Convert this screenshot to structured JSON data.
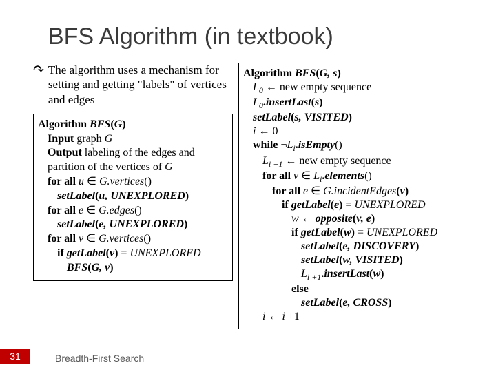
{
  "title": "BFS Algorithm (in textbook)",
  "bullet": "The algorithm uses a mechanism for setting and getting \"labels\" of vertices and edges",
  "bullet_glyph": "↷",
  "left": {
    "l1a": "Algorithm",
    "l1b": "BFS",
    "l1c": "(",
    "l1d": "G",
    "l1e": ")",
    "l2a": "Input",
    "l2b": " graph ",
    "l2c": "G",
    "l3a": "Output",
    "l3b": " labeling of the edges and partition of the vertices  of ",
    "l3c": "G",
    "l4a": "for all ",
    "l4b": "u",
    "l4c": " ∈ ",
    "l4d": "G.vertices",
    "l4e": "()",
    "l5a": "setLabel",
    "l5b": "(",
    "l5c": "u, UNEXPLORED",
    "l5d": ")",
    "l6a": "for all ",
    "l6b": "e",
    "l6c": " ∈ ",
    "l6d": "G.edges",
    "l6e": "()",
    "l7a": "setLabel",
    "l7b": "(",
    "l7c": "e, UNEXPLORED",
    "l7d": ")",
    "l8a": "for all ",
    "l8b": "v",
    "l8c": " ∈ ",
    "l8d": "G.vertices",
    "l8e": "()",
    "l9a": "if  ",
    "l9b": "getLabel",
    "l9c": "(",
    "l9d": "v",
    "l9e": ") ",
    "l9f": "=",
    "l9g": " UNEXPLORED",
    "l10a": "BFS",
    "l10b": "(",
    "l10c": "G, v",
    "l10d": ")"
  },
  "right": {
    "r1a": "Algorithm",
    "r1b": "BFS",
    "r1c": "(",
    "r1d": "G, s",
    "r1e": ")",
    "r2a": "L",
    "r2b": "0",
    "r2c": " ← new empty sequence",
    "r3a": "L",
    "r3b": "0",
    "r3c": ".",
    "r3d": "insertLast",
    "r3e": "(",
    "r3f": "s",
    "r3g": ")",
    "r4a": "setLabel",
    "r4b": "(",
    "r4c": "s, VISITED",
    "r4d": ")",
    "r5a": "i",
    "r5b": " ← 0",
    "r6a": "while  ",
    "r6b": "¬",
    "r6c": "L",
    "r6d": "i",
    "r6e": ".",
    "r6f": "isEmpty",
    "r6g": "()",
    "r7a": "L",
    "r7b": "i +1",
    "r7c": " ← new empty sequence",
    "r8a": "for all ",
    "r8b": "v",
    "r8c": " ∈ ",
    "r8d": "L",
    "r8e": "i",
    "r8f": ".",
    "r8g": "elements",
    "r8h": "()",
    "r9a": "for all ",
    "r9b": "e",
    "r9c": " ∈ ",
    "r9d": "G.incidentEdges",
    "r9e": "(",
    "r9f": "v",
    "r9g": ")",
    "r10a": "if  ",
    "r10b": "getLabel",
    "r10c": "(",
    "r10d": "e",
    "r10e": ") ",
    "r10f": "=",
    "r10g": " UNEXPLORED",
    "r11a": "w",
    "r11b": " ← ",
    "r11c": "opposite",
    "r11d": "(",
    "r11e": "v, e",
    "r11f": ")",
    "r12a": "if ",
    "r12b": " getLabel",
    "r12c": "(",
    "r12d": "w",
    "r12e": ") ",
    "r12f": "=",
    "r12g": " UNEXPLORED",
    "r13a": "setLabel",
    "r13b": "(",
    "r13c": "e, DISCOVERY",
    "r13d": ")",
    "r14a": "setLabel",
    "r14b": "(",
    "r14c": "w, VISITED",
    "r14d": ")",
    "r15a": "L",
    "r15b": "i +1",
    "r15c": ".",
    "r15d": "insertLast",
    "r15e": "(",
    "r15f": "w",
    "r15g": ")",
    "r16a": "else",
    "r17a": "setLabel",
    "r17b": "(",
    "r17c": "e, CROSS",
    "r17d": ")",
    "r18a": "i",
    "r18b": " ← ",
    "r18c": "i",
    "r18d": " +1"
  },
  "footer": "Breadth-First Search",
  "page_number": "31"
}
